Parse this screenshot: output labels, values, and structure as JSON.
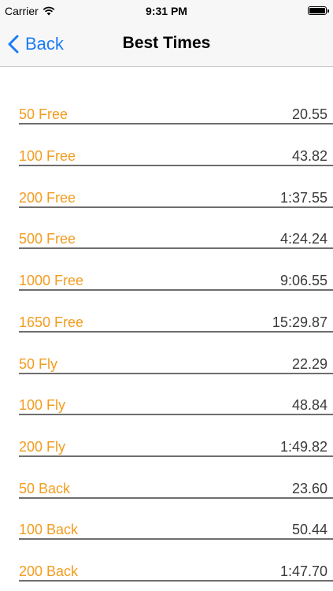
{
  "status_bar": {
    "carrier": "Carrier",
    "time": "9:31 PM"
  },
  "nav": {
    "back_label": "Back",
    "title": "Best Times"
  },
  "colors": {
    "event_label": "#f39c1e",
    "time_value": "#3a3a3a",
    "link_blue": "#1a7cf6"
  },
  "times": [
    {
      "event": "50 Free",
      "time": "20.55"
    },
    {
      "event": "100 Free",
      "time": "43.82"
    },
    {
      "event": "200 Free",
      "time": "1:37.55"
    },
    {
      "event": "500 Free",
      "time": "4:24.24"
    },
    {
      "event": "1000 Free",
      "time": "9:06.55"
    },
    {
      "event": "1650 Free",
      "time": "15:29.87"
    },
    {
      "event": "50 Fly",
      "time": "22.29"
    },
    {
      "event": "100 Fly",
      "time": "48.84"
    },
    {
      "event": "200 Fly",
      "time": "1:49.82"
    },
    {
      "event": "50 Back",
      "time": "23.60"
    },
    {
      "event": "100 Back",
      "time": "50.44"
    },
    {
      "event": "200 Back",
      "time": "1:47.70"
    }
  ]
}
